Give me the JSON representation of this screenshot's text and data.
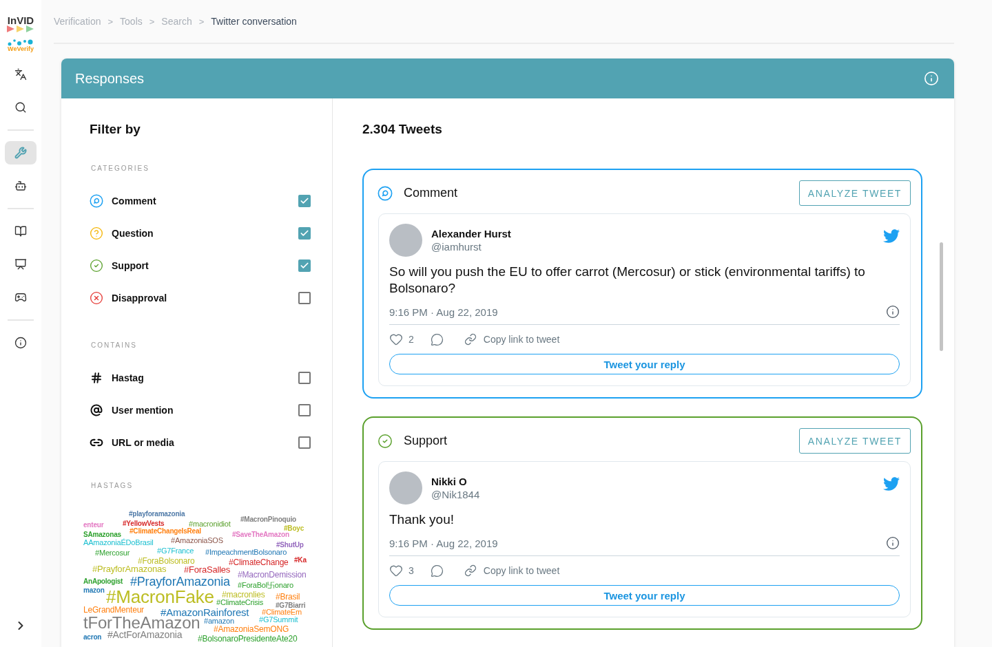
{
  "sidebar": {
    "logo_top": "InVID",
    "logo_bottom": "WeVerify",
    "items": [
      {
        "kind": "translate",
        "selected": false
      },
      {
        "kind": "search",
        "selected": false
      },
      {
        "kind": "divider"
      },
      {
        "kind": "tools",
        "selected": true
      },
      {
        "kind": "assistant",
        "selected": false
      },
      {
        "kind": "divider"
      },
      {
        "kind": "guide",
        "selected": false
      },
      {
        "kind": "classroom",
        "selected": false
      },
      {
        "kind": "game",
        "selected": false
      },
      {
        "kind": "divider"
      },
      {
        "kind": "about",
        "selected": false
      }
    ]
  },
  "breadcrumb": [
    {
      "label": "Verification",
      "separator": ">",
      "current": false
    },
    {
      "label": "Tools",
      "separator": ">",
      "current": false
    },
    {
      "label": "Search",
      "separator": ">",
      "current": false
    },
    {
      "label": "Twitter conversation",
      "current": true
    }
  ],
  "panel": {
    "title": "Responses"
  },
  "filter": {
    "title": "Filter by",
    "sections": [
      {
        "heading": "CATEGORIES",
        "items": [
          {
            "kind": "comment",
            "label": "Comment",
            "checked": true
          },
          {
            "kind": "question",
            "label": "Question",
            "checked": true
          },
          {
            "kind": "support",
            "label": "Support",
            "checked": true
          },
          {
            "kind": "disapproval",
            "label": "Disapproval",
            "checked": false
          }
        ]
      },
      {
        "heading": "CONTAINS",
        "items": [
          {
            "kind": "hashtag",
            "label": "Hastag",
            "checked": false
          },
          {
            "kind": "mention",
            "label": "User mention",
            "checked": false
          },
          {
            "kind": "link",
            "label": "URL or media",
            "checked": false
          }
        ]
      }
    ],
    "hashtags_heading": "HASTAGS",
    "hashtags": [
      {
        "text": "#playforamazonia",
        "color": "#4e79a7"
      },
      {
        "text": "enteur",
        "color": "#e377c2"
      },
      {
        "text": "#YellowVests",
        "color": "#d62728"
      },
      {
        "text": "#macronidiot",
        "color": "#5aa02c"
      },
      {
        "text": "#MacronPinoquio",
        "color": "#7f7f7f"
      },
      {
        "text": "#Boyc",
        "color": "#bcbd22"
      },
      {
        "text": "SAmazonas",
        "color": "#2ca02c"
      },
      {
        "text": "#ClimateChangeIsReal",
        "color": "#ff7f0e"
      },
      {
        "text": "#SaveTheAmazon",
        "color": "#e377c2"
      },
      {
        "text": "AAmazoniaÉDoBrasil",
        "color": "#17becf"
      },
      {
        "text": "#AmazoniaSOS",
        "color": "#8c564b"
      },
      {
        "text": "#ShutUp",
        "color": "#9467bd"
      },
      {
        "text": "#Mercosur",
        "color": "#2ca02c"
      },
      {
        "text": "#G7France",
        "color": "#17becf"
      },
      {
        "text": "#ImpeachmentBolsonaro",
        "color": "#1f77b4"
      },
      {
        "text": "#ForaBolsonaro",
        "color": "#bcbd22"
      },
      {
        "text": "#ClimateChange",
        "color": "#d62728"
      },
      {
        "text": "#Ka",
        "color": "#d62728"
      },
      {
        "text": "#PrayforAmazonas",
        "color": "#bcbd22"
      },
      {
        "text": "#ForaSalles",
        "color": "#d62728"
      },
      {
        "text": "#MacronDemission",
        "color": "#9467bd"
      },
      {
        "text": "AnApologist",
        "color": "#2ca02c"
      },
      {
        "text": "#PrayforAmazonia",
        "color": "#1f77b4"
      },
      {
        "text": "#ForaBol卐onaro",
        "color": "#2ca02c"
      },
      {
        "text": "mazon",
        "color": "#1f77b4"
      },
      {
        "text": "#MacronFake",
        "color": "#bcbd22"
      },
      {
        "text": "#macronlies",
        "color": "#bcbd22"
      },
      {
        "text": "#Brasil",
        "color": "#ff7f0e"
      },
      {
        "text": "#ClimateCrisis",
        "color": "#2ca02c"
      },
      {
        "text": "#G7Biarri",
        "color": "#7f7f7f"
      },
      {
        "text": "LeGrandMenteur",
        "color": "#ff7f0e"
      },
      {
        "text": "#AmazonRainforest",
        "color": "#1f77b4"
      },
      {
        "text": "#ClimateEm",
        "color": "#ff7f0e"
      },
      {
        "text": "tForTheAmazon",
        "color": "#7f7f7f"
      },
      {
        "text": "#amazon",
        "color": "#1f77b4"
      },
      {
        "text": "#G7Summit",
        "color": "#17becf"
      },
      {
        "text": "acron",
        "color": "#1f77b4"
      },
      {
        "text": "#ActForAmazonia",
        "color": "#7f7f7f"
      },
      {
        "text": "#AmazoniaSemONG",
        "color": "#ff7f0e"
      },
      {
        "text": "#BolsonaroPresidenteAte20",
        "color": "#2ca02c"
      }
    ]
  },
  "results": {
    "count": "2.304 Tweets",
    "tweets": [
      {
        "kind": "comment",
        "category": "Comment",
        "button": "ANALYZE TWEET",
        "name": "Alexander Hurst",
        "handle": "@iamhurst",
        "text": "So will you push the EU to offer carrot (Mercosur) or stick (environmental tariffs) to Bolsonaro?",
        "time": "9:16 PM · Aug 22, 2019",
        "likes": "2",
        "copy_link": "Copy link to tweet",
        "reply": "Tweet your reply"
      },
      {
        "kind": "support",
        "category": "Support",
        "button": "ANALYZE TWEET",
        "name": "Nikki O",
        "handle": "@Nik1844",
        "text": "Thank you!",
        "time": "9:16 PM · Aug 22, 2019",
        "likes": "3",
        "copy_link": "Copy link to tweet",
        "reply": "Tweet your reply"
      }
    ]
  }
}
